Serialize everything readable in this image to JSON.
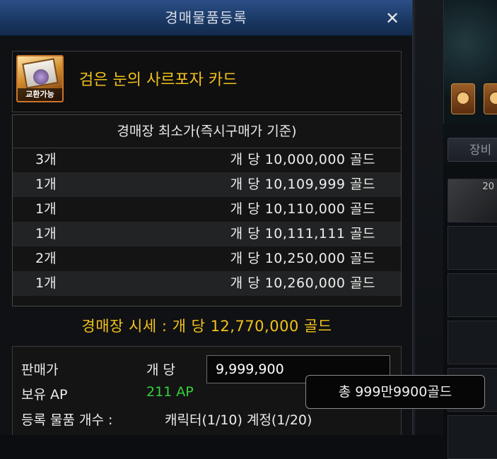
{
  "dialog": {
    "title": "경매물품등록",
    "close_label": "✕"
  },
  "item": {
    "name": "검은 눈의 사르포자 카드",
    "badge": "교환가능",
    "icon": "card-item-icon"
  },
  "auction_table": {
    "header": "경매장 최소가(즉시구매가 기준)",
    "rows": [
      {
        "qty": "3개",
        "price": "개 당 10,000,000 골드"
      },
      {
        "qty": "1개",
        "price": "개 당 10,109,999 골드"
      },
      {
        "qty": "1개",
        "price": "개 당 10,110,000 골드"
      },
      {
        "qty": "1개",
        "price": "개 당 10,111,111 골드"
      },
      {
        "qty": "2개",
        "price": "개 당 10,250,000 골드"
      },
      {
        "qty": "1개",
        "price": "개 당 10,260,000 골드"
      }
    ]
  },
  "market_price": "경매장 시세 : 개 당 12,770,000 골드",
  "sale": {
    "price_label": "판매가",
    "per_unit_label": "개 당",
    "price_value": "9,999,900",
    "ap_label": "보유 AP",
    "ap_value": "211 AP",
    "count_label": "등록 물품 개수 :",
    "count_value": "캐릭터(1/10) 계정(1/20)",
    "total_tooltip": "총 999만9900골드"
  },
  "background": {
    "tab_label": "장비",
    "slot_badge": "20"
  },
  "colors": {
    "title_bar": "#1b3965",
    "item_name": "#f2c21b",
    "market_price": "#f2c21b",
    "ap_value": "#35d13a"
  }
}
